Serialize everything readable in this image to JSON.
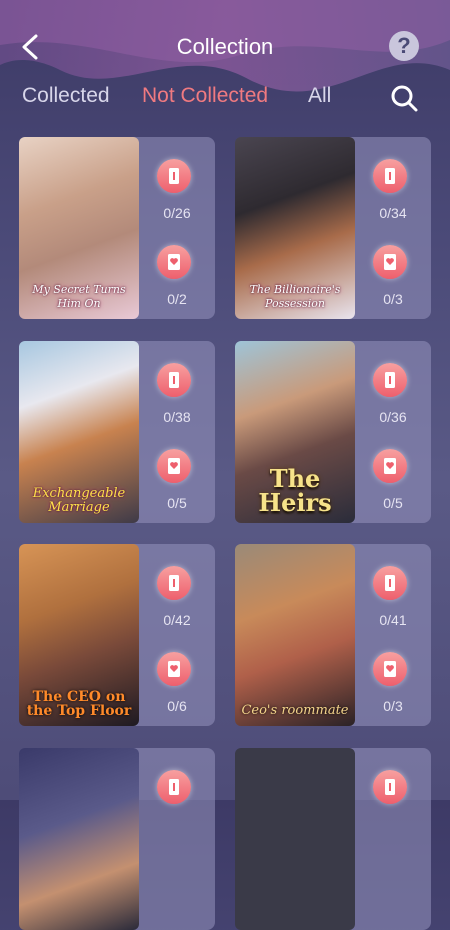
{
  "header": {
    "title": "Collection"
  },
  "tabs": [
    {
      "label": "Collected",
      "active": false
    },
    {
      "label": "Not Collected",
      "active": true
    },
    {
      "label": "All",
      "active": false
    }
  ],
  "books": [
    {
      "title": "My Secret Turns Him On",
      "scenes": "0/26",
      "hearts": "0/2"
    },
    {
      "title": "The Billionaire's Possession",
      "scenes": "0/34",
      "hearts": "0/3"
    },
    {
      "title": "Exchangeable Marriage",
      "scenes": "0/38",
      "hearts": "0/5"
    },
    {
      "title": "The Heirs",
      "scenes": "0/36",
      "hearts": "0/5"
    },
    {
      "title": "The CEO on the Top Floor",
      "scenes": "0/42",
      "hearts": "0/6"
    },
    {
      "title": "Ceo's roommate",
      "scenes": "0/41",
      "hearts": "0/3"
    }
  ],
  "colors": {
    "accent": "#f07a80",
    "icon_gradient_top": "#f7a0a0",
    "icon_gradient_bottom": "#ee5f6d"
  }
}
